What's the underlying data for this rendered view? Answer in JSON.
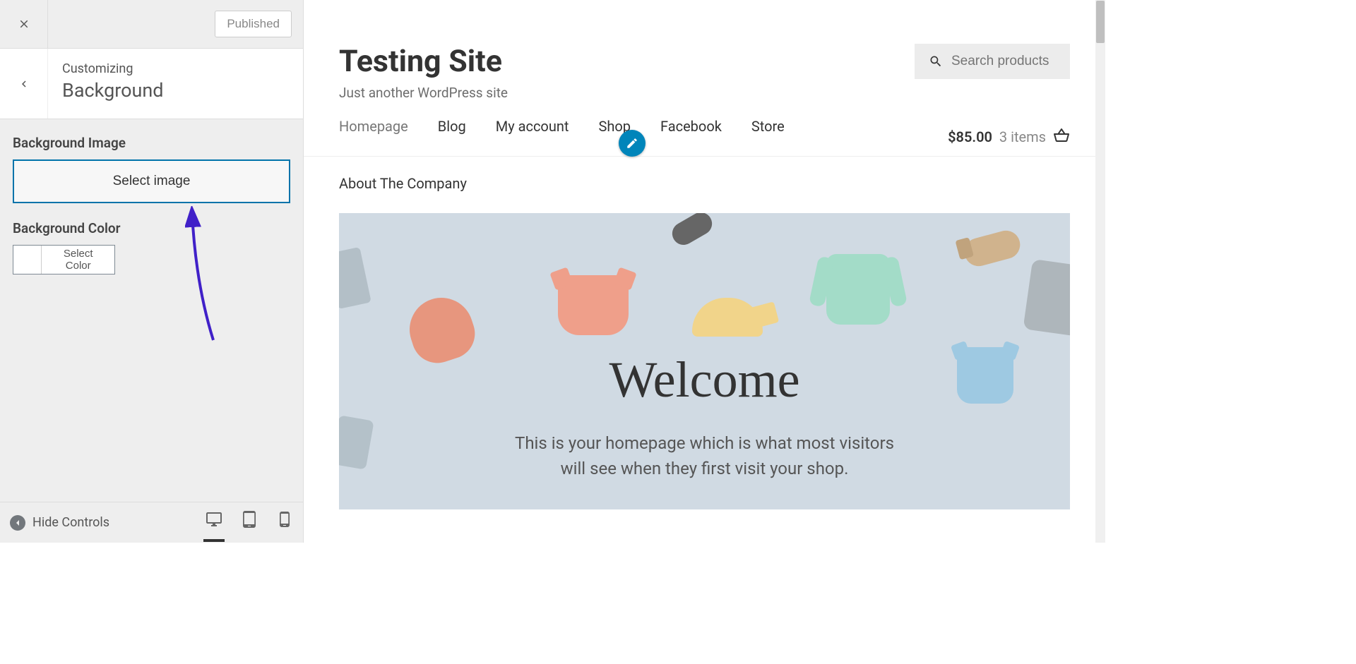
{
  "sidebar": {
    "published_label": "Published",
    "customizing_label": "Customizing",
    "section_title": "Background",
    "bg_image_label": "Background Image",
    "select_image_label": "Select image",
    "bg_color_label": "Background Color",
    "select_color_label": "Select Color",
    "hide_controls_label": "Hide Controls"
  },
  "site": {
    "title": "Testing Site",
    "tagline": "Just another WordPress site",
    "search_placeholder": "Search products"
  },
  "nav": {
    "items": [
      "Homepage",
      "Blog",
      "My account",
      "Shop",
      "Facebook",
      "Store"
    ],
    "row2": "About The Company"
  },
  "cart": {
    "price": "$85.00",
    "count": "3 items"
  },
  "hero": {
    "title": "Welcome",
    "text_line1": "This is your homepage which is what most visitors",
    "text_line2": "will see when they first visit your shop."
  }
}
